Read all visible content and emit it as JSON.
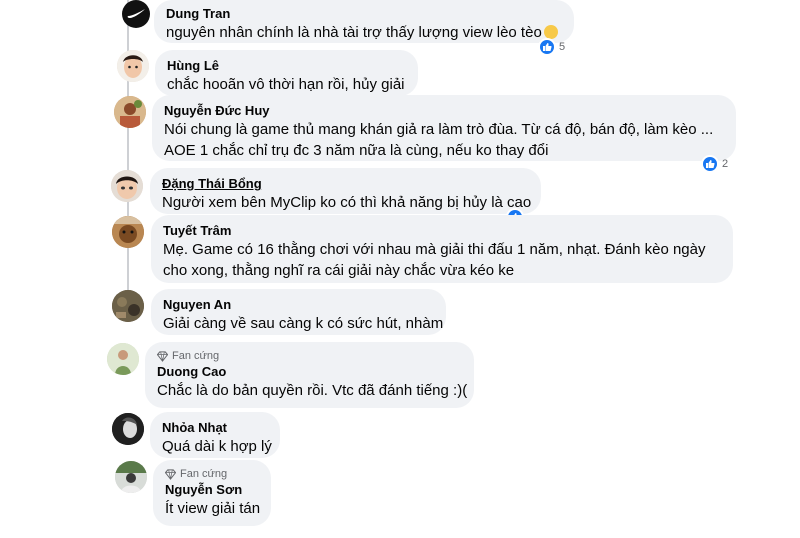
{
  "comments": [
    {
      "name": "Dung Tran",
      "lines": [
        "nguyên nhân chính là nhà tài trợ thấy lượng view lèo tèo"
      ],
      "reaction_count": "5"
    },
    {
      "name": "Hùng Lê",
      "lines": [
        "chắc hooãn vô thời hạn rồi, hủy giải"
      ]
    },
    {
      "name": "Nguyễn Đức Huy",
      "lines": [
        "Nói chung là game thủ mang khán giả ra làm trò đùa. Từ cá độ, bán độ, làm kèo ...",
        "AOE 1 chắc chỉ trụ đc 3 năm nữa là cùng, nếu ko thay đổi"
      ],
      "reaction_count": "2"
    },
    {
      "name": "Đặng Thái Bổng",
      "lines": [
        "Người xem bên MyClip ko có thì khả năng bị hủy là cao"
      ]
    },
    {
      "name": "Tuyết Trâm",
      "lines": [
        "Mẹ. Game có 16 thằng chơi với nhau mà giải thi đấu 1 năm, nhạt. Đánh kèo ngày",
        "cho xong, thằng nghĩ ra cái giải này chắc vừa kéo ke"
      ]
    },
    {
      "name": "Nguyen An",
      "lines": [
        "Giải càng về sau càng k có sức hút, nhàm"
      ]
    },
    {
      "badge": "Fan cứng",
      "name": "Duong Cao",
      "lines": [
        "Chắc là do bản quyền rồi. Vtc đã đánh tiếng :)("
      ]
    },
    {
      "name": "Nhỏa Nhạt",
      "lines": [
        "Quá dài k hợp lý"
      ]
    },
    {
      "badge": "Fan cứng",
      "name": "Nguyễn Sơn",
      "lines": [
        "Ít view giải tán"
      ]
    }
  ],
  "colors": {
    "bubble": "#f0f2f5",
    "like": "#1877f2",
    "thread": "#ced0d4",
    "meta": "#65676b"
  },
  "icons": {
    "reaction": "like-icon",
    "badge": "diamond-icon"
  }
}
